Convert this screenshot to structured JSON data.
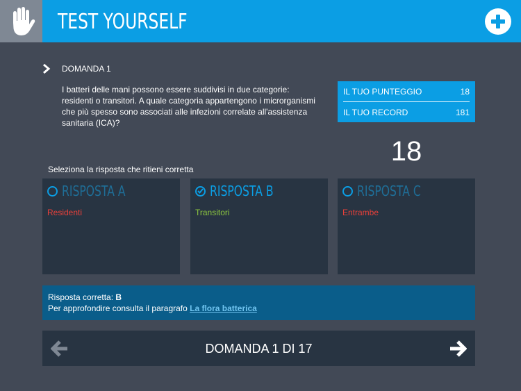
{
  "header": {
    "title": "TEST YOURSELF",
    "hand_icon": "hand-icon",
    "plus_icon": "plus-circle-icon"
  },
  "question": {
    "label": "DOMANDA 1",
    "text": "I batteri delle mani possono essere suddivisi in due categorie: residenti o transitori. A quale categoria appartengono i microrganismi che più spesso sono associati alle infezioni correlate all'assistenza sanitaria (ICA)?"
  },
  "score": {
    "current_label": "IL TUO PUNTEGGIO",
    "current_value": "18",
    "record_label": "IL TUO RECORD",
    "record_value": "181"
  },
  "timer": "18",
  "instruction": "Seleziona la risposta che ritieni corretta",
  "answers": [
    {
      "title": "RISPOSTA A",
      "text": "Residenti",
      "text_color": "#e8403a",
      "selected": false
    },
    {
      "title": "RISPOSTA B",
      "text": "Transitori",
      "text_color": "#8cc63f",
      "selected": true
    },
    {
      "title": "RISPOSTA C",
      "text": "Entrambe",
      "text_color": "#e8403a",
      "selected": false
    }
  ],
  "feedback": {
    "correct_prefix": "Risposta corretta: ",
    "correct_letter": "B",
    "more_prefix": "Per approfondire consulta il paragrafo ",
    "link_text": "La flora batterica"
  },
  "nav": {
    "label": "DOMANDA 1 DI 17",
    "prev_icon": "arrow-left-icon",
    "next_icon": "arrow-right-icon"
  },
  "colors": {
    "accent": "#0b9ee4",
    "background": "#424956",
    "panel": "#283442",
    "feedback_bg": "#0a5d8a"
  }
}
